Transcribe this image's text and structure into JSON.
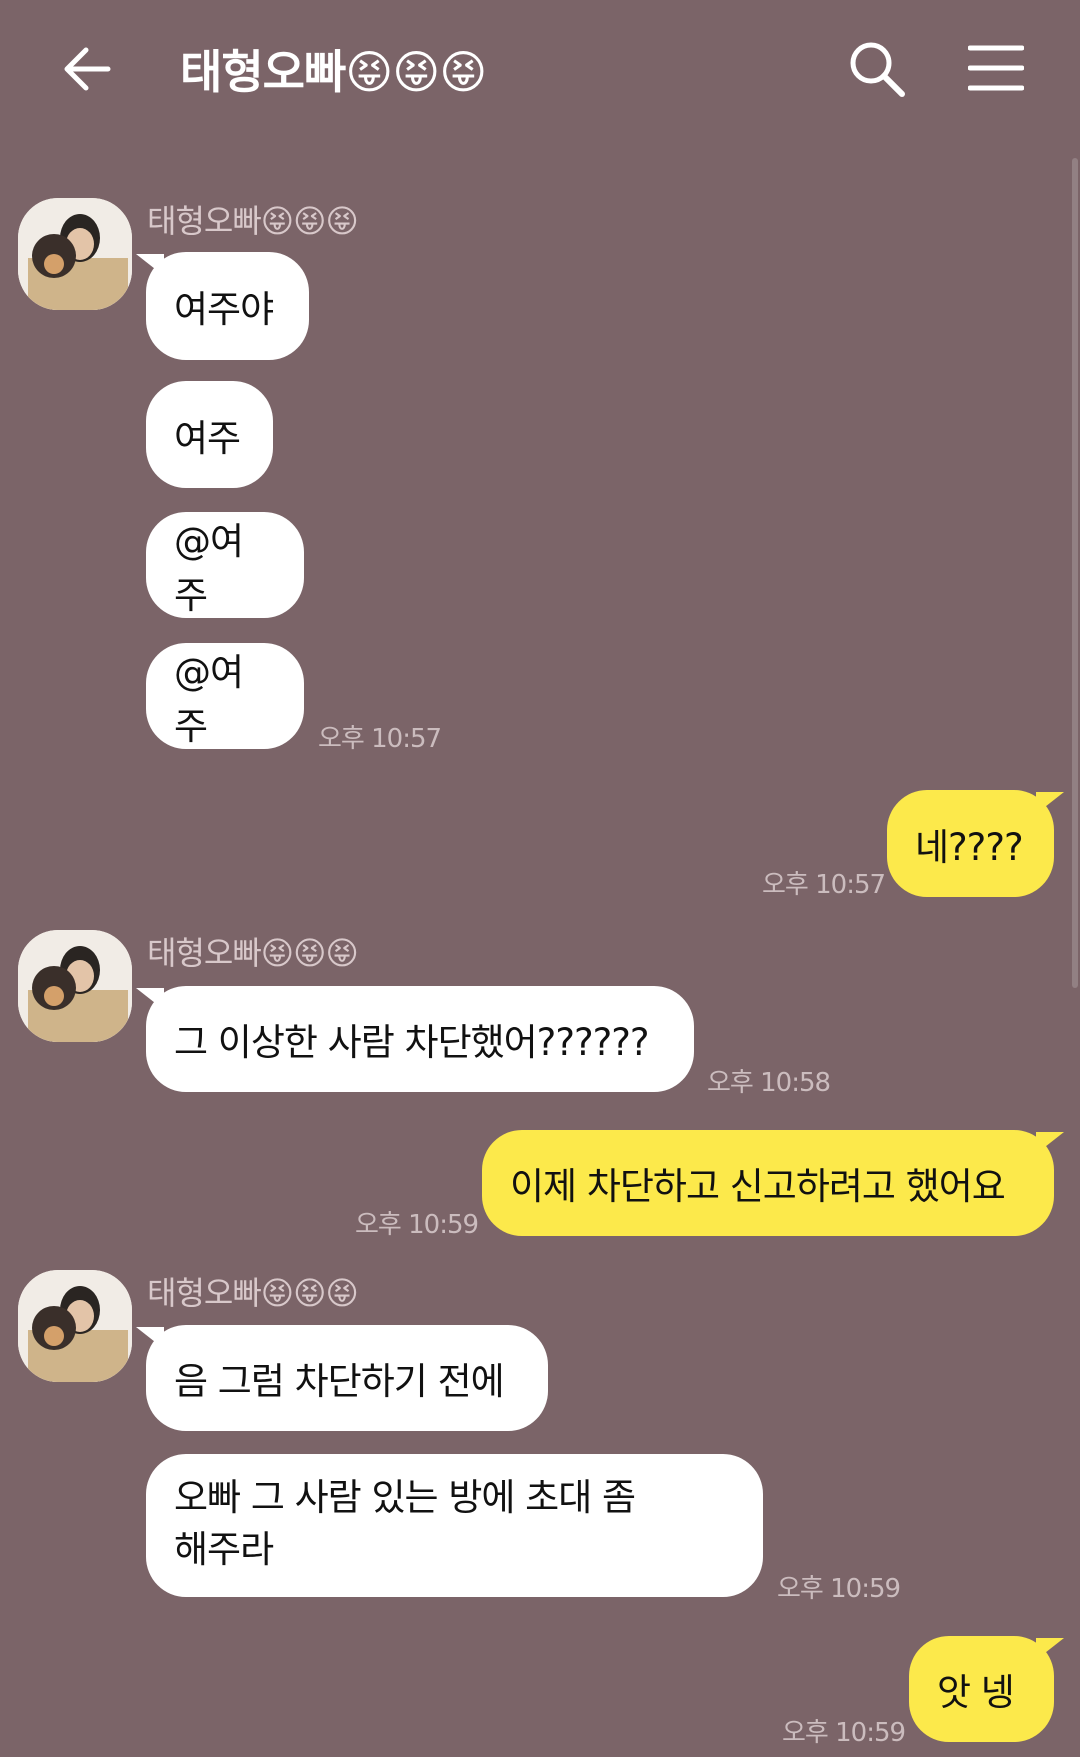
{
  "header": {
    "title": "태형오빠😝😝😝",
    "back_icon": "arrow-left-icon",
    "search_icon": "search-icon",
    "menu_icon": "hamburger-menu-icon"
  },
  "colors": {
    "background": "#7b6468",
    "incoming_bubble": "#ffffff",
    "outgoing_bubble": "#fce94b"
  },
  "messages": {
    "g1": {
      "sender": "태형오빠😝😝😝",
      "lines": [
        "여주야",
        "여주",
        "@여주",
        "@여주"
      ],
      "time": "오후 10:57"
    },
    "o1": {
      "text": "네????",
      "time": "오후 10:57"
    },
    "g2": {
      "sender": "태형오빠😝😝😝",
      "lines": [
        "그 이상한 사람 차단했어??????"
      ],
      "time": "오후 10:58"
    },
    "o2": {
      "text": "이제 차단하고 신고하려고 했어요",
      "time": "오후 10:59"
    },
    "g3": {
      "sender": "태형오빠😝😝😝",
      "lines": [
        "음 그럼 차단하기 전에",
        "오빠 그 사람 있는 방에 초대 좀\n해주라"
      ],
      "time": "오후 10:59"
    },
    "o3": {
      "text": "앗 넹",
      "time": "오후 10:59"
    }
  }
}
